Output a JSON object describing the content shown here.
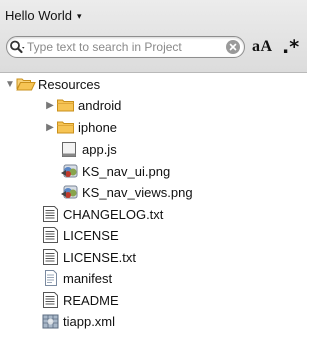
{
  "header": {
    "project_name": "Hello World",
    "dropdown_arrow": "▾"
  },
  "search": {
    "placeholder": "Type text to search in Project",
    "case_toggle_label": "aA",
    "regex_toggle_label": ".*"
  },
  "tree": {
    "items": [
      {
        "label": "Resources",
        "icon": "folder-open-icon",
        "expanded": true
      },
      {
        "label": "android",
        "icon": "folder-icon",
        "expanded": false
      },
      {
        "label": "iphone",
        "icon": "folder-icon",
        "expanded": false
      },
      {
        "label": "app.js",
        "icon": "js-file-icon"
      },
      {
        "label": "KS_nav_ui.png",
        "icon": "image-file-icon"
      },
      {
        "label": "KS_nav_views.png",
        "icon": "image-file-icon"
      },
      {
        "label": "CHANGELOG.txt",
        "icon": "text-file-icon"
      },
      {
        "label": "LICENSE",
        "icon": "text-file-icon"
      },
      {
        "label": "LICENSE.txt",
        "icon": "text-file-icon"
      },
      {
        "label": "manifest",
        "icon": "document-icon"
      },
      {
        "label": "README",
        "icon": "text-file-icon"
      },
      {
        "label": "tiapp.xml",
        "icon": "xml-file-icon"
      }
    ]
  },
  "colors": {
    "folder_fill": "#f6c454",
    "folder_outline": "#c9901c",
    "header_bg": "#dcdcdc"
  }
}
